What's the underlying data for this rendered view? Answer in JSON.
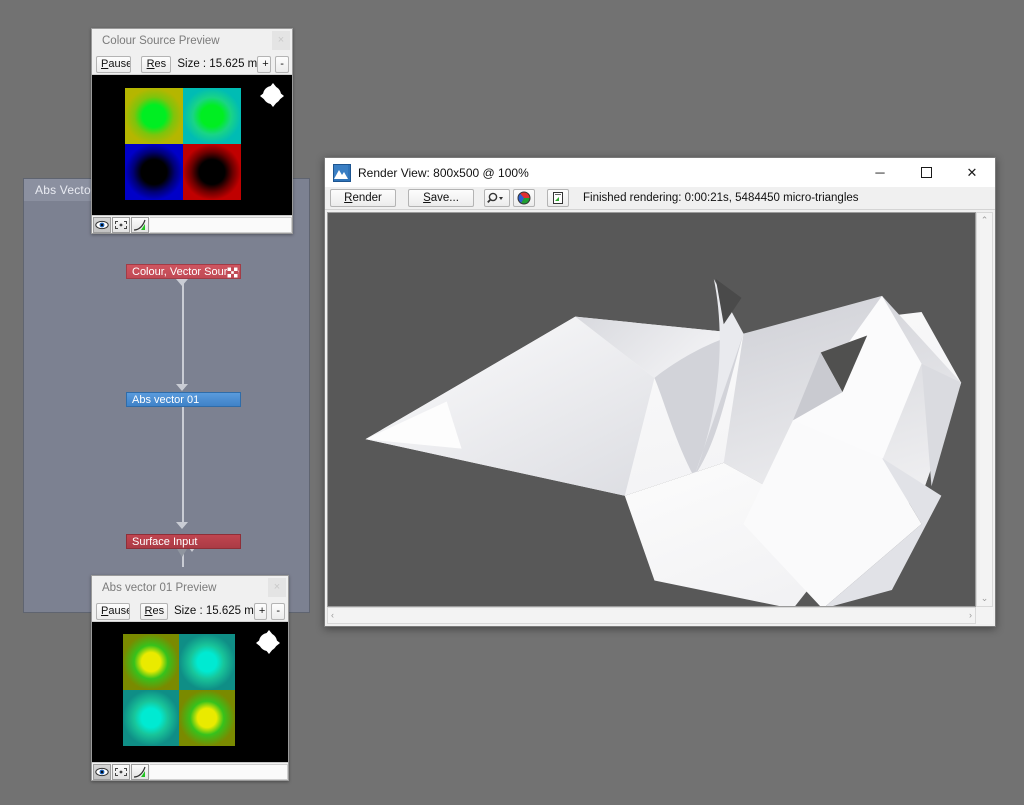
{
  "desktop": {
    "background_color": "#727272"
  },
  "node_graph": {
    "title": "Abs Vector",
    "background_color": "#7c8191",
    "nodes": [
      {
        "label": "Colour, Vector Source",
        "color": "#cf5560",
        "icon": "grid-plus-icon",
        "type": "source"
      },
      {
        "label": "Abs vector 01",
        "color": "#4f8fd4",
        "icon": "",
        "type": "operator",
        "selected": true
      },
      {
        "label": "Surface Input",
        "color": "#c04550",
        "icon": "",
        "type": "input"
      }
    ]
  },
  "preview_top": {
    "title": "Colour Source Preview",
    "close_label": "×",
    "toolbar": {
      "pause_label": "Pause",
      "pause_accel": "P",
      "res_label": "Res",
      "size_label": "Size :  15.625 m",
      "plus_label": "+",
      "minus_label": "-"
    },
    "footer_icons": [
      "eye-icon",
      "fit-icon",
      "curve-icon"
    ],
    "nav_widget": "pan-navigator",
    "swatches": {
      "top_left": {
        "outer": "#b5b600",
        "inner": "#00e81e"
      },
      "top_right": {
        "outer": "#00bcb4",
        "inner": "#00e82a"
      },
      "bottom_left": {
        "outer": "#0000c4",
        "inner": "#000000"
      },
      "bottom_right": {
        "outer": "#b80000",
        "inner": "#000000"
      }
    }
  },
  "preview_bottom": {
    "title": "Abs vector 01 Preview",
    "close_label": "×",
    "toolbar": {
      "pause_label": "Pause",
      "pause_accel": "P",
      "res_label": "Res",
      "size_label": "Size :  15.625 m",
      "plus_label": "+",
      "minus_label": "-"
    },
    "footer_icons": [
      "eye-icon",
      "fit-icon",
      "curve-icon"
    ],
    "nav_widget": "pan-navigator",
    "swatches": {
      "top_left": {
        "outer": "#8a9200",
        "inner": "#e8e800"
      },
      "top_right": {
        "outer": "#0f9a8e",
        "inner": "#00e8d2"
      },
      "bottom_left": {
        "outer": "#0f9a8e",
        "inner": "#00e8d2"
      },
      "bottom_right": {
        "outer": "#8a9200",
        "inner": "#e8e800"
      }
    }
  },
  "render_view": {
    "window_icon": "terrain-icon",
    "title": "Render View: 800x500 @ 100%",
    "window_buttons": {
      "minimize": "─",
      "maximize": "☐",
      "close": "✕"
    },
    "toolbar": {
      "render_label": "Render",
      "render_accel": "R",
      "save_label": "Save...",
      "save_accel": "S",
      "zoom_icon": "magnifier-dropdown-icon",
      "colour_icon": "colour-wheel-icon",
      "crop_icon": "document-icon"
    },
    "status": "Finished rendering:  0:00:21s, 5484450 micro-triangles",
    "canvas_background": "#585858",
    "scrollbars": {
      "vertical_up": "⌃",
      "vertical_down": "⌄",
      "horizontal_left": "‹",
      "horizontal_right": "›"
    }
  }
}
